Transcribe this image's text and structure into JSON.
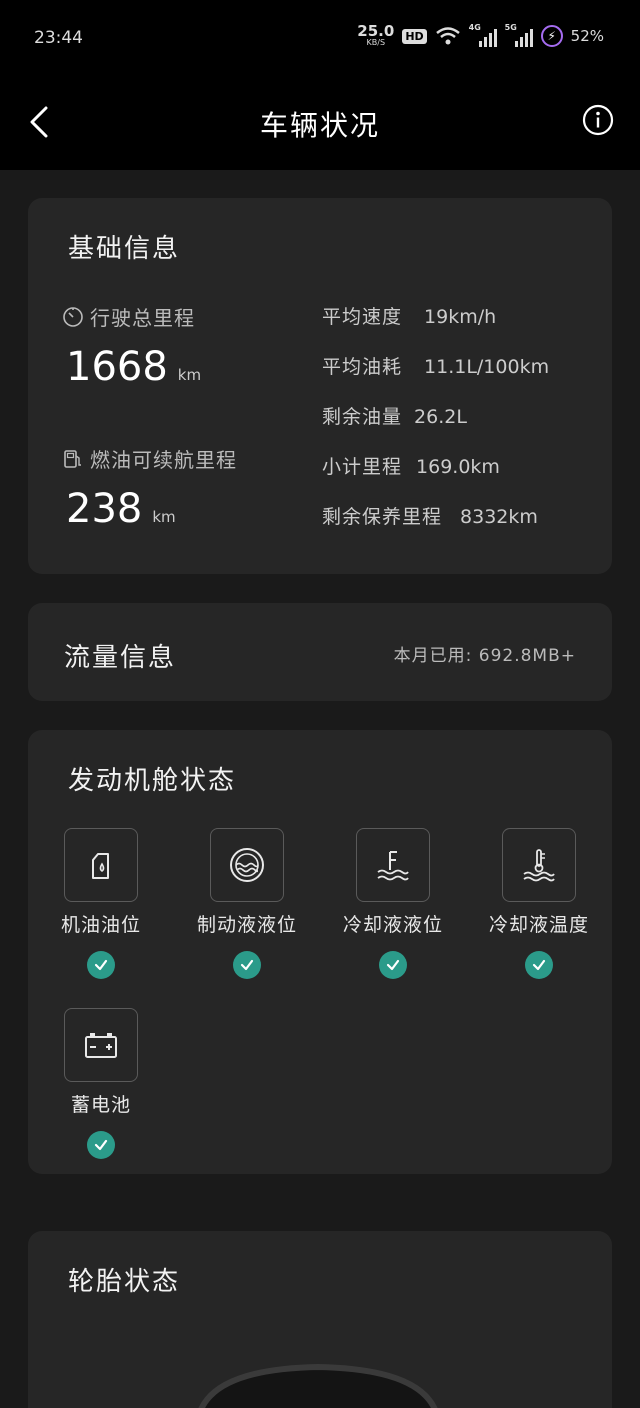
{
  "status_bar": {
    "time": "23:44",
    "speed_value": "25.0",
    "speed_unit": "KB/S",
    "hd": "HD",
    "net1": "4G",
    "net2": "5G",
    "battery": "52%"
  },
  "header": {
    "title": "车辆状况",
    "back_icon": "chevron-left-icon",
    "info_icon": "info-icon"
  },
  "basic": {
    "title": "基础信息",
    "total_mileage_label": "行驶总里程",
    "total_mileage_value": "1668",
    "total_mileage_unit": "km",
    "range_label": "燃油可续航里程",
    "range_value": "238",
    "range_unit": "km",
    "stats": [
      {
        "label": "平均速度",
        "value": "19km/h"
      },
      {
        "label": "平均油耗",
        "value": "11.1L/100km"
      },
      {
        "label": "剩余油量",
        "value": "26.2L"
      },
      {
        "label": "小计里程",
        "value": "169.0km"
      },
      {
        "label": "剩余保养里程",
        "value": "8332km"
      }
    ]
  },
  "flow": {
    "title": "流量信息",
    "usage": "本月已用: 692.8MB+"
  },
  "engine": {
    "title": "发动机舱状态",
    "items": [
      {
        "label": "机油油位",
        "icon": "oil-can-icon"
      },
      {
        "label": "制动液液位",
        "icon": "brake-fluid-icon"
      },
      {
        "label": "冷却液液位",
        "icon": "coolant-level-icon"
      },
      {
        "label": "冷却液温度",
        "icon": "coolant-temp-icon"
      },
      {
        "label": "蓄电池",
        "icon": "battery-icon"
      }
    ],
    "status_icon": "check-icon",
    "accent": "#2b9b8a"
  },
  "tire": {
    "title": "轮胎状态"
  }
}
